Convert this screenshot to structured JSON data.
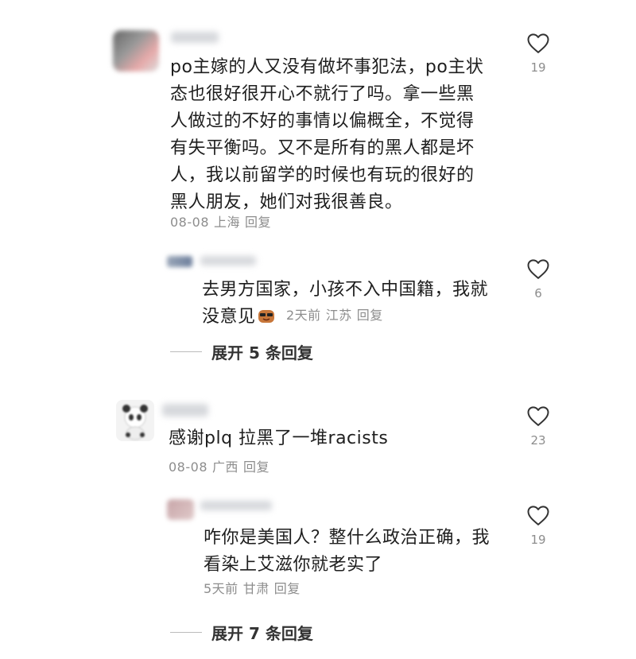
{
  "comments": [
    {
      "text": "po主嫁的人又没有做坏事犯法，po主状态也很好很开心不就行了吗。拿一些黑人做过的不好的事情以偏概全，不觉得有失平衡吗。又不是所有的黑人都是坏人，我以前留学的时候也有玩的很好的黑人朋友，她们对我很善良。",
      "lines": [
        "po主嫁的人又没有做坏事犯法，po主状",
        "态也很好很开心不就行了吗。拿一些黑",
        "人做过的不好的事情以偏概全，不觉得",
        "有失平衡吗。又不是所有的黑人都是坏",
        "人，我以前留学的时候也有玩的很好的",
        "黑人朋友，她们对我很善良。"
      ],
      "date": "08-08",
      "location": "上海",
      "reply_label": "回复",
      "likes": "19",
      "reply": {
        "lines": [
          "去男方国家，小孩不入中国籍，我就",
          "没意见"
        ],
        "time": "2天前",
        "location": "江苏",
        "reply_label": "回复",
        "likes": "6"
      },
      "expand_label": "展开 5 条回复"
    },
    {
      "text": "感谢plq 拉黑了一堆racists",
      "lines": [
        "感谢plq 拉黑了一堆racists"
      ],
      "date": "08-08",
      "location": "广西",
      "reply_label": "回复",
      "likes": "23",
      "reply": {
        "lines": [
          "咋你是美国人？整什么政治正确，我",
          "看染上艾滋你就老实了"
        ],
        "time": "5天前",
        "location": "甘肃",
        "reply_label": "回复",
        "likes": "19"
      },
      "expand_label": "展开 7 条回复"
    }
  ],
  "icons": {
    "like": "heart-outline-icon",
    "emoji": "face-emoji-icon"
  },
  "colors": {
    "text": "#1e1e1e",
    "meta": "#8d8d8d",
    "heart": "#333333"
  }
}
